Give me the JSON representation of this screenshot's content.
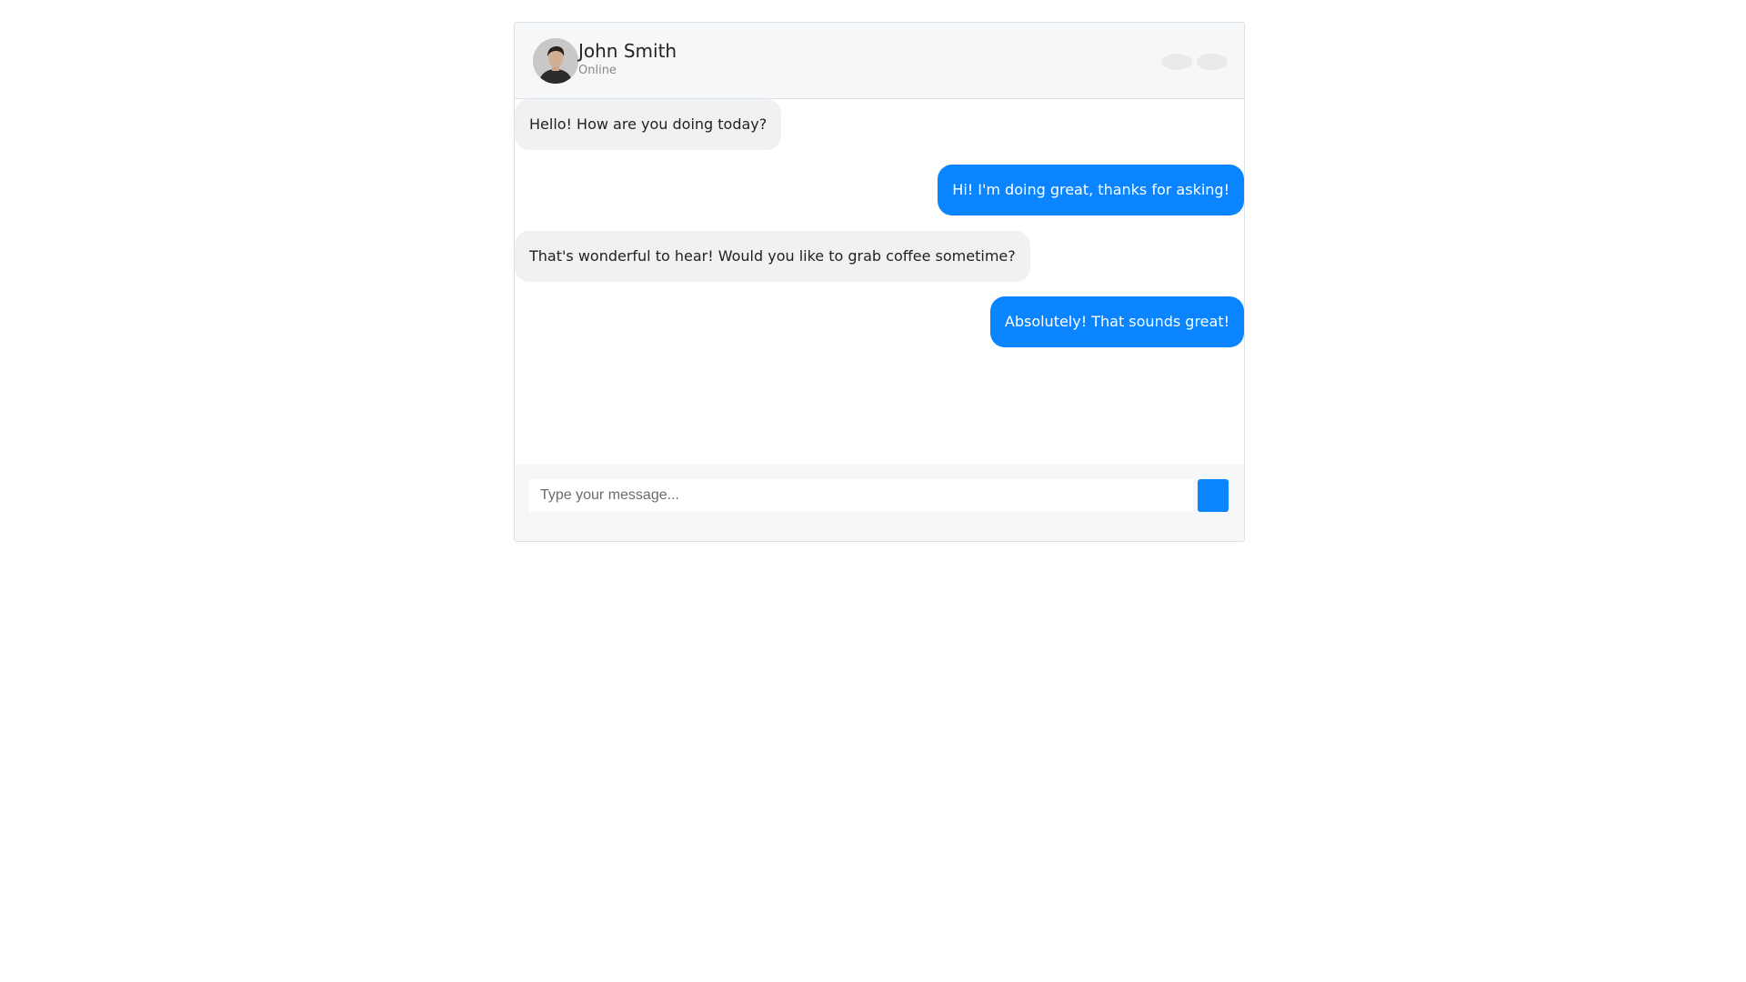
{
  "header": {
    "contact_name": "John Smith",
    "contact_status": "Online",
    "actions": [
      "call-icon",
      "more-icon"
    ]
  },
  "messages": [
    {
      "direction": "received",
      "text": "Hello! How are you doing today?"
    },
    {
      "direction": "sent",
      "text": "Hi! I'm doing great, thanks for asking!"
    },
    {
      "direction": "received",
      "text": "That's wonderful to hear! Would you like to grab coffee sometime?"
    },
    {
      "direction": "sent",
      "text": "Absolutely! That sounds great!"
    }
  ],
  "composer": {
    "placeholder": "Type your message...",
    "value": ""
  },
  "colors": {
    "accent": "#0a84ff",
    "received_bubble": "#f0f1f3",
    "header_bg": "#f6f7f9"
  }
}
